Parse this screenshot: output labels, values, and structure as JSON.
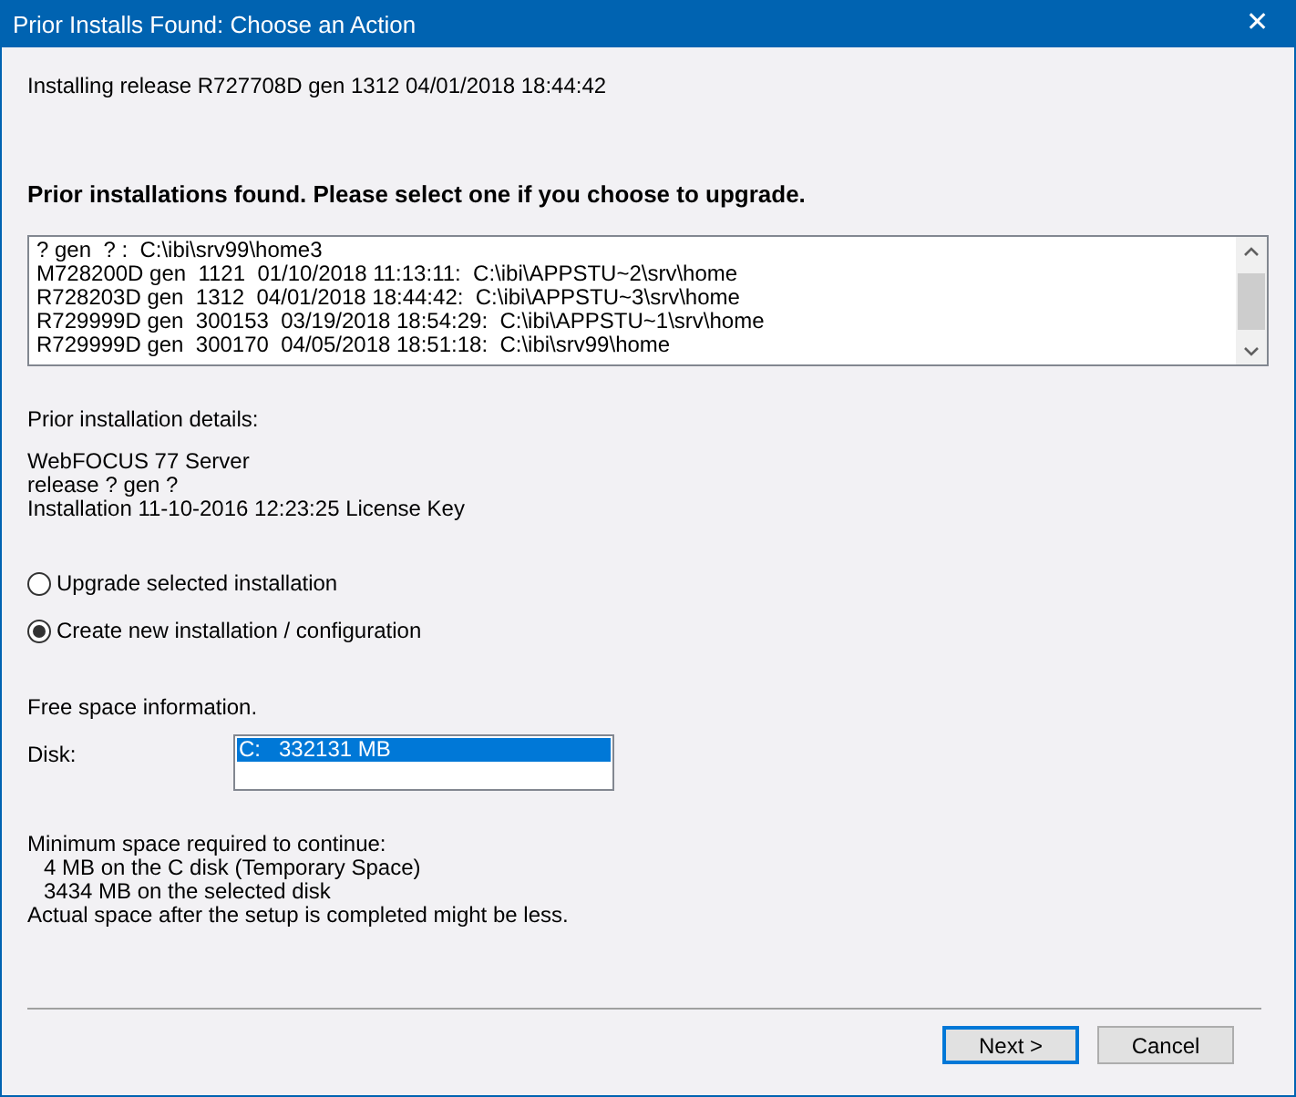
{
  "window": {
    "title": "Prior Installs Found: Choose an Action",
    "close": "✕"
  },
  "installing": "Installing release R727708D gen 1312 04/01/2018 18:44:42",
  "heading": "Prior installations found. Please select one if you choose to upgrade.",
  "installations": [
    {
      "label": "? gen  ? :  C:\\ibi\\srv99\\home3",
      "selected": false
    },
    {
      "label": "M728200D gen  1121  01/10/2018 11:13:11:  C:\\ibi\\APPSTU~2\\srv\\home",
      "selected": false
    },
    {
      "label": "R728203D gen  1312  04/01/2018 18:44:42:  C:\\ibi\\APPSTU~3\\srv\\home",
      "selected": false
    },
    {
      "label": "R729999D gen  300153  03/19/2018 18:54:29:  C:\\ibi\\APPSTU~1\\srv\\home",
      "selected": false
    },
    {
      "label": "R729999D gen  300170  04/05/2018 18:51:18:  C:\\ibi\\srv99\\home",
      "selected": false
    }
  ],
  "details": {
    "label": "Prior installation details:",
    "lines": [
      "WebFOCUS 77 Server",
      "release ? gen ?",
      "Installation 11-10-2016 12:23:25 License Key"
    ]
  },
  "options": [
    {
      "label": "Upgrade selected installation",
      "selected": false
    },
    {
      "label": "Create new installation / configuration",
      "selected": true
    }
  ],
  "free_space": {
    "label": "Free space information.",
    "disk_label": "Disk:",
    "disks": [
      {
        "label": "C:   332131 MB",
        "selected": true
      }
    ]
  },
  "minimum": {
    "title": "Minimum space required to continue:",
    "items": [
      "4 MB on the C disk (Temporary Space)",
      "3434 MB on the selected disk"
    ],
    "note": "Actual space after the setup is completed might be less."
  },
  "buttons": [
    {
      "label": "Next >",
      "default": true
    },
    {
      "label": "Cancel",
      "default": false
    }
  ]
}
